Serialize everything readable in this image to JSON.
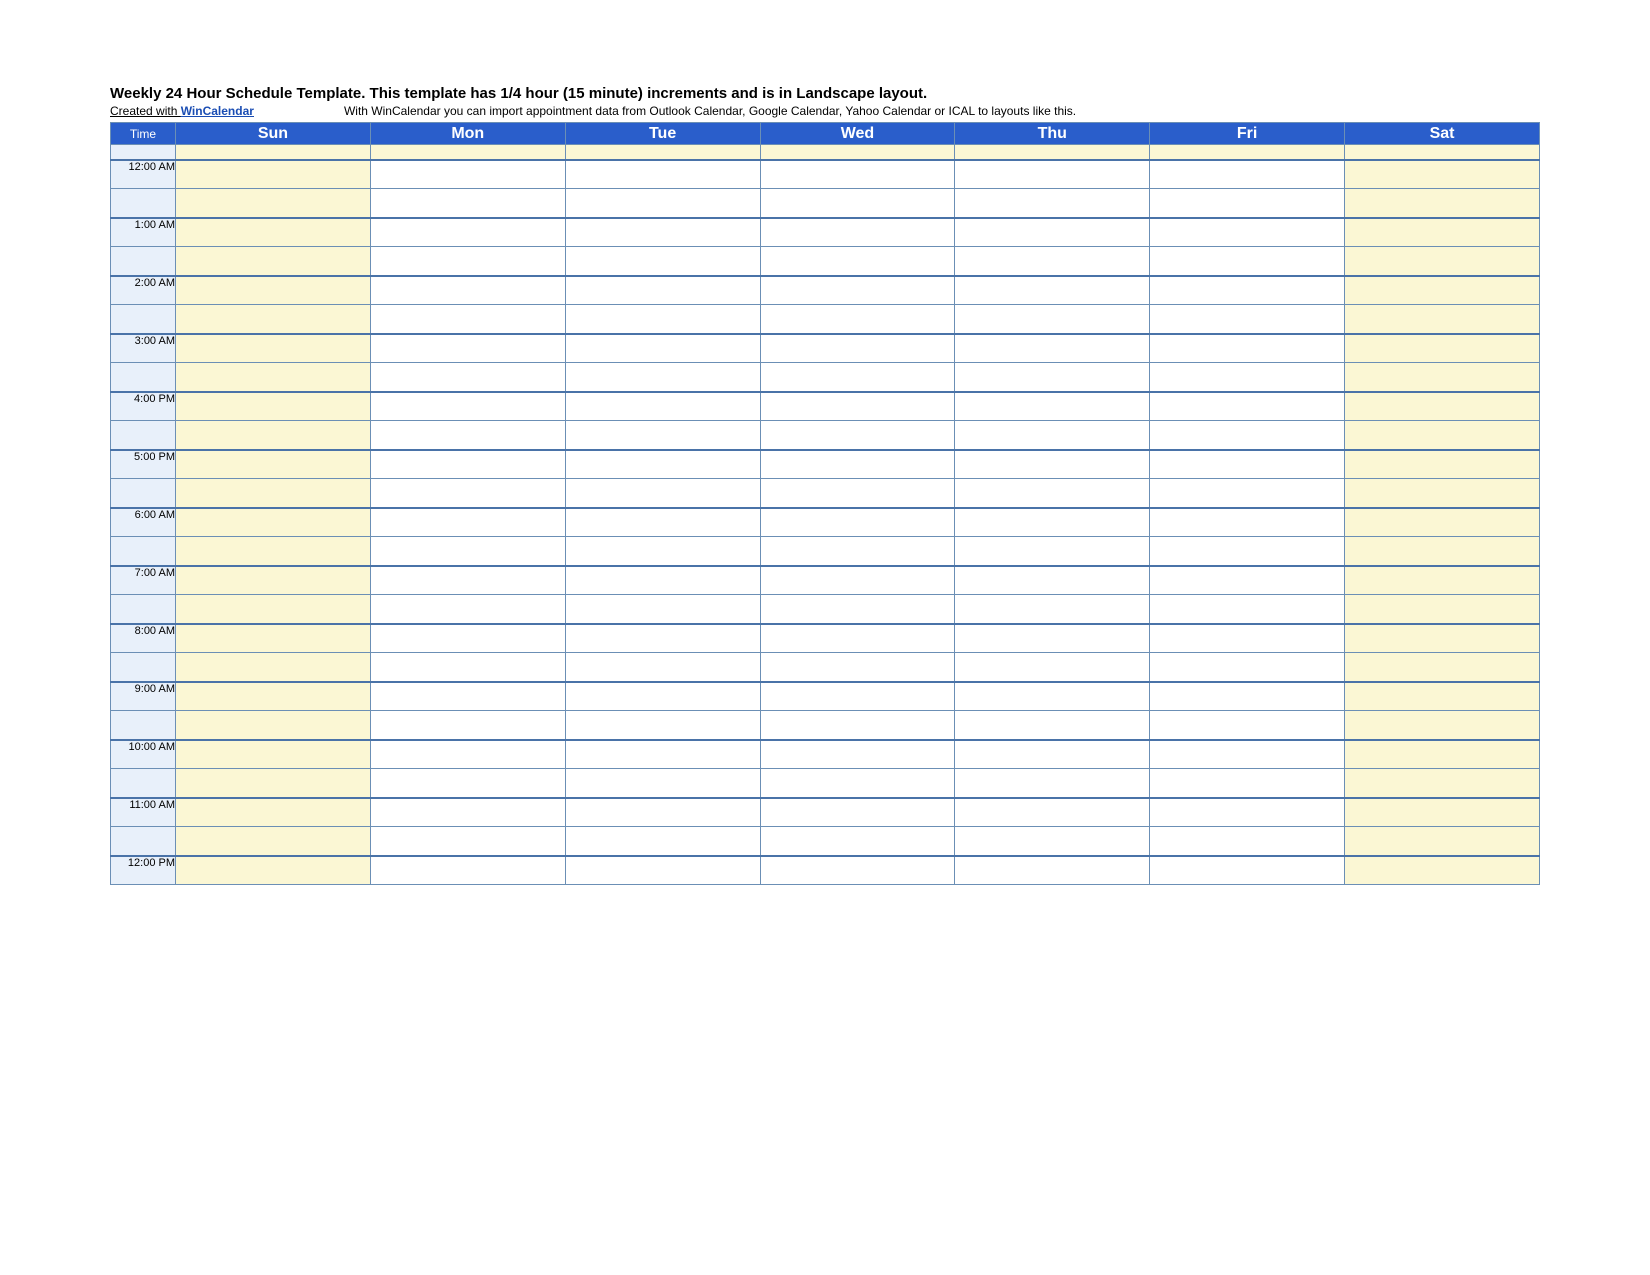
{
  "header": {
    "title": "Weekly 24 Hour Schedule Template.  This template has 1/4 hour (15 minute) increments and is in Landscape layout.",
    "created_prefix": "Created with ",
    "created_link": "WinCalendar",
    "import_note": "With WinCalendar you can import appointment data from Outlook Calendar, Google Calendar, Yahoo Calendar or ICAL to layouts like this."
  },
  "columns": {
    "time_label": "Time",
    "days": [
      "Sun",
      "Mon",
      "Tue",
      "Wed",
      "Thu",
      "Fri",
      "Sat"
    ]
  },
  "time_rows": [
    "12:00 AM",
    "1:00 AM",
    "2:00 AM",
    "3:00 AM",
    "4:00 PM",
    "5:00 PM",
    "6:00 AM",
    "7:00 AM",
    "8:00 AM",
    "9:00 AM",
    "10:00 AM",
    "11:00 AM",
    "12:00 PM"
  ],
  "weekend_indices": [
    0,
    6
  ]
}
